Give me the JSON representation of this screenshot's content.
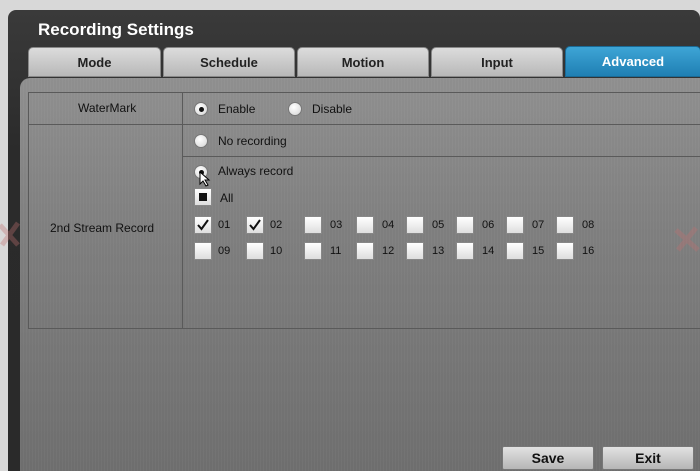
{
  "window": {
    "title": "Recording Settings"
  },
  "tabs": [
    {
      "label": "Mode",
      "active": false
    },
    {
      "label": "Schedule",
      "active": false
    },
    {
      "label": "Motion",
      "active": false
    },
    {
      "label": "Input",
      "active": false
    },
    {
      "label": "Advanced",
      "active": true
    }
  ],
  "watermark": {
    "label": "WaterMark",
    "options": [
      {
        "label": "Enable",
        "selected": true
      },
      {
        "label": "Disable",
        "selected": false
      }
    ]
  },
  "second_stream": {
    "label": "2nd Stream Record",
    "options": [
      {
        "label": "No recording",
        "selected": false
      },
      {
        "label": "Always record",
        "selected": true
      }
    ],
    "all_label": "All",
    "channels": [
      {
        "num": "01",
        "checked": true
      },
      {
        "num": "02",
        "checked": true
      },
      {
        "num": "03",
        "checked": false
      },
      {
        "num": "04",
        "checked": false
      },
      {
        "num": "05",
        "checked": false
      },
      {
        "num": "06",
        "checked": false
      },
      {
        "num": "07",
        "checked": false
      },
      {
        "num": "08",
        "checked": false
      },
      {
        "num": "09",
        "checked": false
      },
      {
        "num": "10",
        "checked": false
      },
      {
        "num": "11",
        "checked": false
      },
      {
        "num": "12",
        "checked": false
      },
      {
        "num": "13",
        "checked": false
      },
      {
        "num": "14",
        "checked": false
      },
      {
        "num": "15",
        "checked": false
      },
      {
        "num": "16",
        "checked": false
      }
    ]
  },
  "buttons": {
    "save": "Save",
    "exit": "Exit"
  },
  "colors": {
    "active_tab": "#2f93c7",
    "panel": "#828282",
    "frame": "#2e2e2e"
  }
}
